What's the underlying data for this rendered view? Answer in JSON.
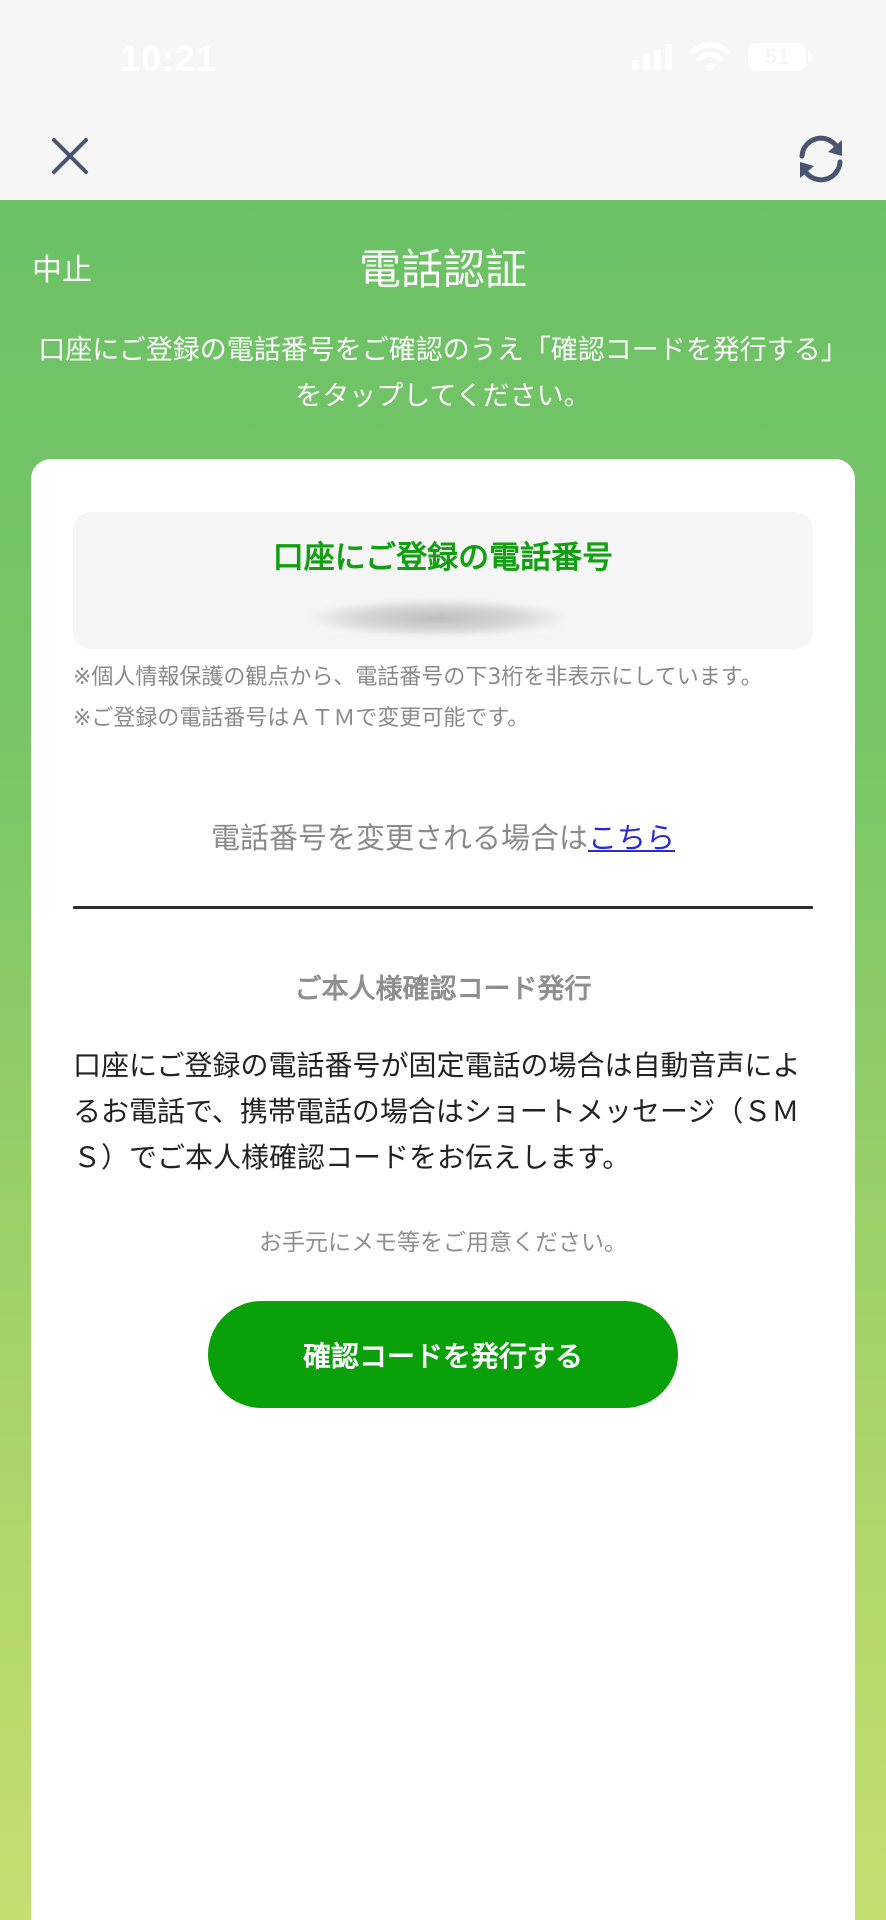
{
  "status_bar": {
    "time": "10:21",
    "battery": "51"
  },
  "nav": {
    "close_icon": "close-icon",
    "reload_icon": "reload-icon"
  },
  "header": {
    "cancel_label": "中止",
    "title": "電話認証",
    "intro": "口座にご登録の電話番号をご確認のうえ「確認コードを発行する」をタップしてください。"
  },
  "phone_box": {
    "title": "口座にご登録の電話番号"
  },
  "notes": {
    "line1": "※個人情報保護の観点から、電話番号の下3桁を非表示にしています。",
    "line2": "※ご登録の電話番号はＡＴＭで変更可能です。"
  },
  "change": {
    "text": "電話番号を変更される場合は",
    "link": "こちら"
  },
  "section": {
    "title": "ご本人様確認コード発行",
    "body": "口座にご登録の電話番号が固定電話の場合は自動音声によるお電話で、携帯電話の場合はショートメッセージ（ＳＭＳ）でご本人様確認コードをお伝えします。",
    "memo": "お手元にメモ等をご用意ください。"
  },
  "button": {
    "label": "確認コードを発行する"
  },
  "colors": {
    "green_accent": "#0aa00a",
    "header_green": "#6bc266",
    "link_blue": "#2a2ad6"
  }
}
